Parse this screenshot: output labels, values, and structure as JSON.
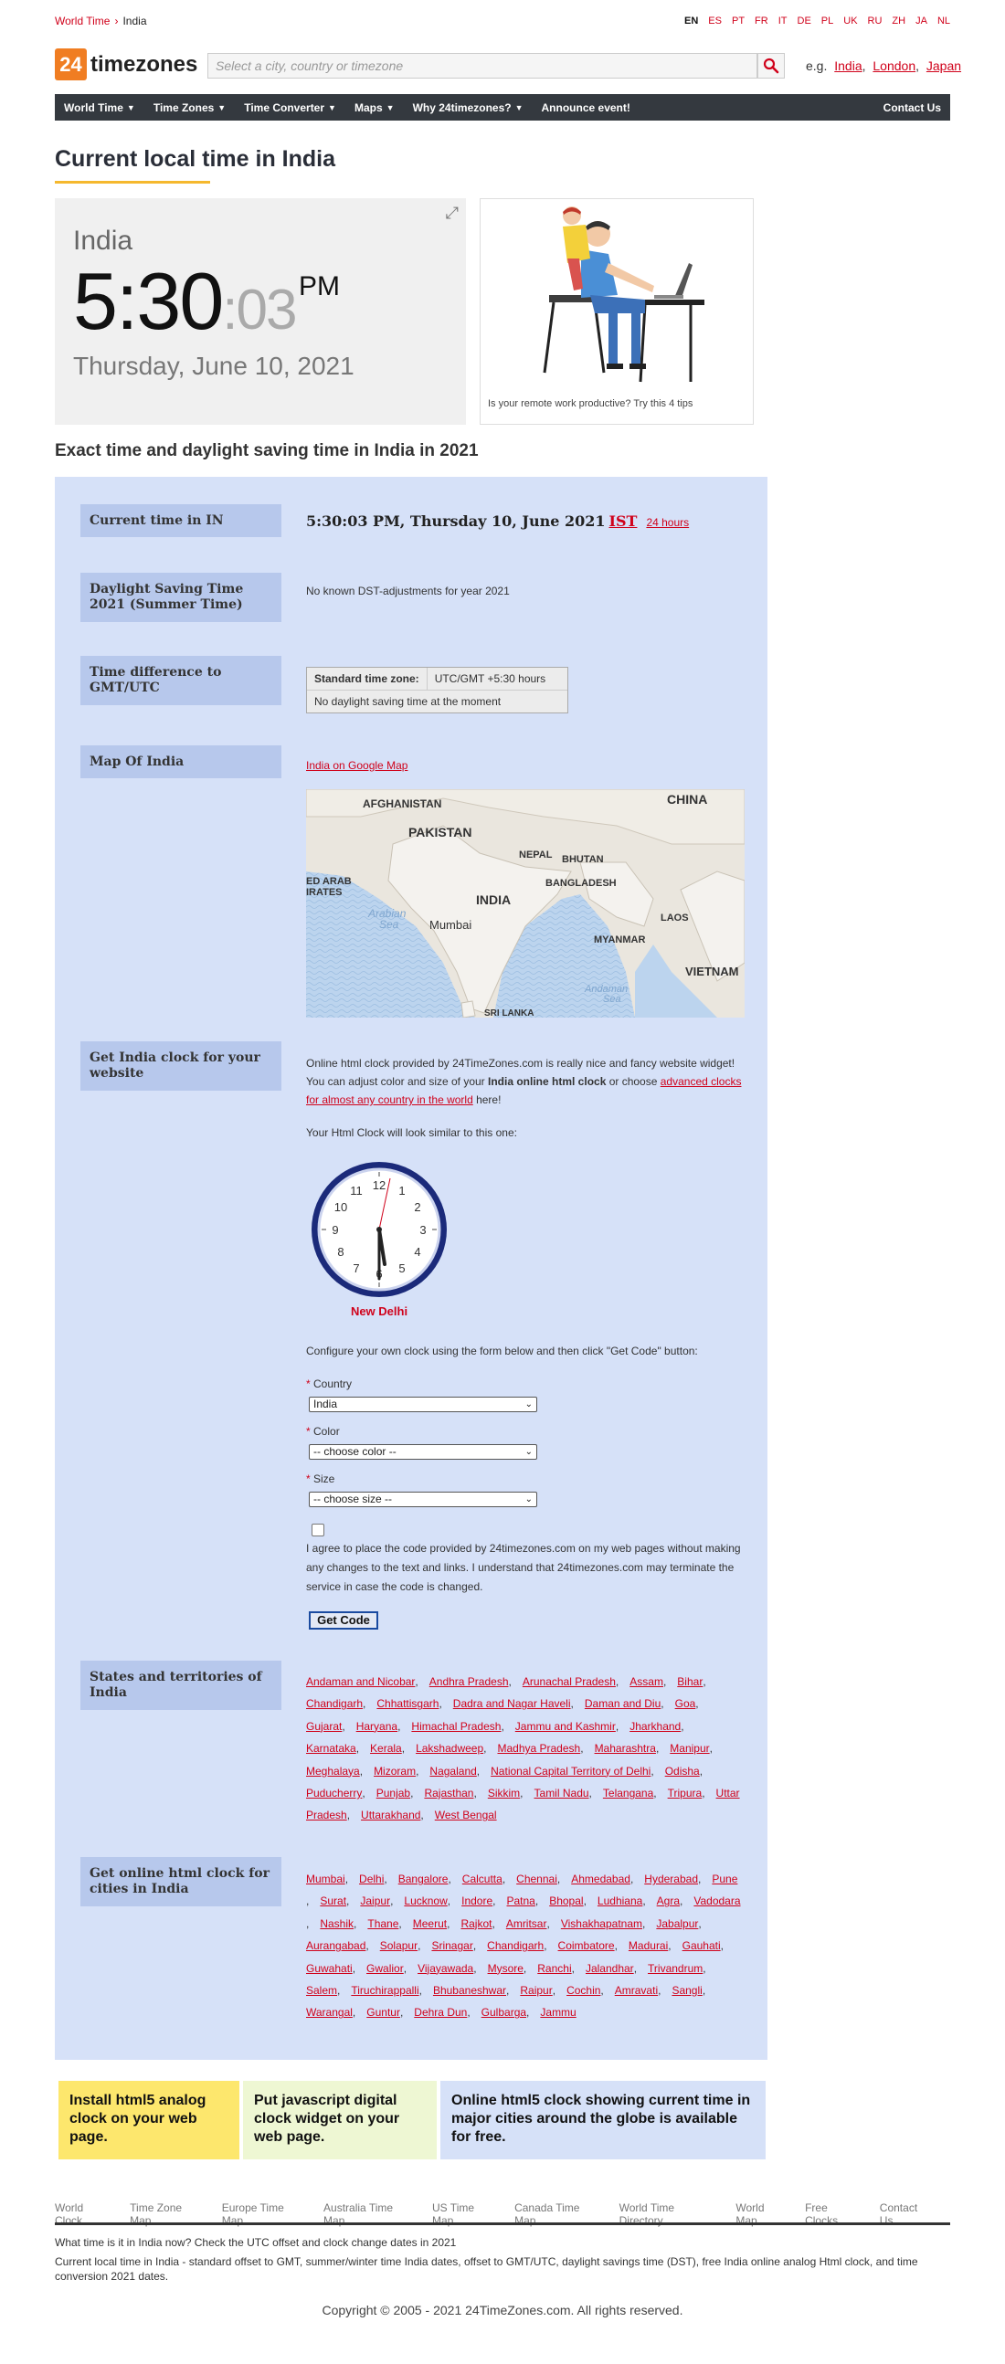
{
  "breadcrumb": {
    "root": "World Time",
    "current": "India"
  },
  "languages": [
    "EN",
    "ES",
    "PT",
    "FR",
    "IT",
    "DE",
    "PL",
    "UK",
    "RU",
    "ZH",
    "JA",
    "NL"
  ],
  "logo": {
    "badge": "24",
    "text": "timezones"
  },
  "search": {
    "placeholder": "Select a city, country or timezone",
    "eg_label": "e.g.",
    "examples": [
      "India",
      "London",
      "Japan"
    ]
  },
  "nav": {
    "items": [
      "World Time",
      "Time Zones",
      "Time Converter",
      "Maps",
      "Why 24timezones?"
    ],
    "announce": "Announce event!",
    "contact": "Contact Us"
  },
  "page_title": "Current local time in India",
  "clock": {
    "country": "India",
    "hm": "5:30",
    "secs": ":03",
    "ampm": "PM",
    "date": "Thursday, June 10, 2021"
  },
  "ad": {
    "caption": "Is your remote work productive? Try this 4 tips"
  },
  "section_title": "Exact time and daylight saving time in India in 2021",
  "rows": {
    "current": {
      "label": "Current time in IN",
      "value": "5:30:03 PM, Thursday 10, June 2021",
      "tz": "IST",
      "h24": "24 hours"
    },
    "dst": {
      "label": "Daylight Saving Time 2021 (Summer Time)",
      "value": "No known DST-adjustments for year 2021"
    },
    "diff": {
      "label": "Time difference to GMT/UTC",
      "std_key": "Standard time zone:",
      "std_val": "UTC/GMT +5:30 hours",
      "note": "No daylight saving time at the moment"
    },
    "map": {
      "label": "Map Of India",
      "link": "India on Google Map",
      "places": [
        "AFGHANISTAN",
        "PAKISTAN",
        "NEPAL",
        "BHUTAN",
        "CHINA",
        "ED ARAB",
        "IRATES",
        "BANGLADESH",
        "INDIA",
        "Arabian",
        "Sea",
        "Mumbai",
        "LAOS",
        "MYANMAR",
        "VIETNAM",
        "Andaman",
        "Sea",
        "SRI LANKA"
      ]
    },
    "widget": {
      "label": "Get India clock for your website",
      "p1a": "Online html clock provided by 24TimeZones.com is really nice and fancy website widget! You can adjust color and size of your ",
      "p1b": "India online html clock",
      "p1c": " or choose ",
      "p1link": "advanced clocks for almost any country in the world",
      "p1d": " here!",
      "p2": "Your Html Clock will look similar to this one:",
      "clock_city": "New Delhi",
      "clock_numbers": [
        "12",
        "1",
        "2",
        "3",
        "4",
        "5",
        "6",
        "7",
        "8",
        "9",
        "10",
        "11"
      ],
      "p3": "Configure your own clock using the form below and then click \"Get Code\" button:",
      "country_label": "Country",
      "country_value": "India",
      "color_label": "Color",
      "color_value": "-- choose color --",
      "size_label": "Size",
      "size_value": "-- choose size --",
      "agree": "I agree to place the code provided by 24timezones.com on my web pages without making any changes to the text and links. I understand that 24timezones.com may terminate the service in case the code is changed.",
      "button": "Get Code"
    },
    "states": {
      "label": "States and territories of India",
      "items": [
        "Andaman and Nicobar",
        "Andhra Pradesh",
        "Arunachal Pradesh",
        "Assam",
        "Bihar",
        "Chandigarh",
        "Chhattisgarh",
        "Dadra and Nagar Haveli",
        "Daman and Diu",
        "Goa",
        "Gujarat",
        "Haryana",
        "Himachal Pradesh",
        "Jammu and Kashmir",
        "Jharkhand",
        "Karnataka",
        "Kerala",
        "Lakshadweep",
        "Madhya Pradesh",
        "Maharashtra",
        "Manipur",
        "Meghalaya",
        "Mizoram",
        "Nagaland",
        "National Capital Territory of Delhi",
        "Odisha",
        "Puducherry",
        "Punjab",
        "Rajasthan",
        "Sikkim",
        "Tamil Nadu",
        "Telangana",
        "Tripura",
        "Uttar Pradesh",
        "Uttarakhand",
        "West Bengal"
      ]
    },
    "cities": {
      "label": "Get online html clock for cities in India",
      "items": [
        "Mumbai",
        "Delhi",
        "Bangalore",
        "Calcutta",
        "Chennai",
        "Ahmedabad",
        "Hyderabad",
        "Pune",
        "Surat",
        "Jaipur",
        "Lucknow",
        "Indore",
        "Patna",
        "Bhopal",
        "Ludhiana",
        "Agra",
        "Vadodara",
        "Nashik",
        "Thane",
        "Meerut",
        "Rajkot",
        "Amritsar",
        "Vishakhapatnam",
        "Jabalpur",
        "Aurangabad",
        "Solapur",
        "Srinagar",
        "Chandigarh",
        "Coimbatore",
        "Madurai",
        "Gauhati",
        "Guwahati",
        "Gwalior",
        "Vijayawada",
        "Mysore",
        "Ranchi",
        "Jalandhar",
        "Trivandrum",
        "Salem",
        "Tiruchirappalli",
        "Bhubaneshwar",
        "Raipur",
        "Cochin",
        "Amravati",
        "Sangli",
        "Warangal",
        "Guntur",
        "Dehra Dun",
        "Gulbarga",
        "Jammu"
      ]
    }
  },
  "promos": [
    {
      "text": "Install html5 analog clock on your web page.",
      "color": "#fde76d"
    },
    {
      "text": "Put javascript digital clock widget on your web page.",
      "color": "#eef7d3"
    },
    {
      "text": "Online html5 clock showing current time in major cities around the globe is available for free.",
      "color": "#d6e1f8"
    }
  ],
  "footer": {
    "links": [
      "World Clock",
      "Time Zone Map",
      "Europe Time Map",
      "Australia Time Map",
      "US Time Map",
      "Canada Time Map",
      "World Time Directory",
      "World Map",
      "Free Clocks",
      "Contact Us"
    ],
    "line1": "What time is it in India now? Check the UTC offset and clock change dates in 2021",
    "line2": "Current local time in India - standard offset to GMT, summer/winter time India dates, offset to GMT/UTC, daylight savings time (DST), free India online analog Html clock, and time conversion 2021 dates.",
    "copyright": "Copyright © 2005 - 2021 24TimeZones.com. All rights reserved."
  },
  "colors": {
    "accent": "#d0021b",
    "logo": "#f07d22",
    "nav": "#34393f",
    "panel": "#d6e1f8",
    "label": "#b7c8ec",
    "underline": "#f5b82e"
  }
}
